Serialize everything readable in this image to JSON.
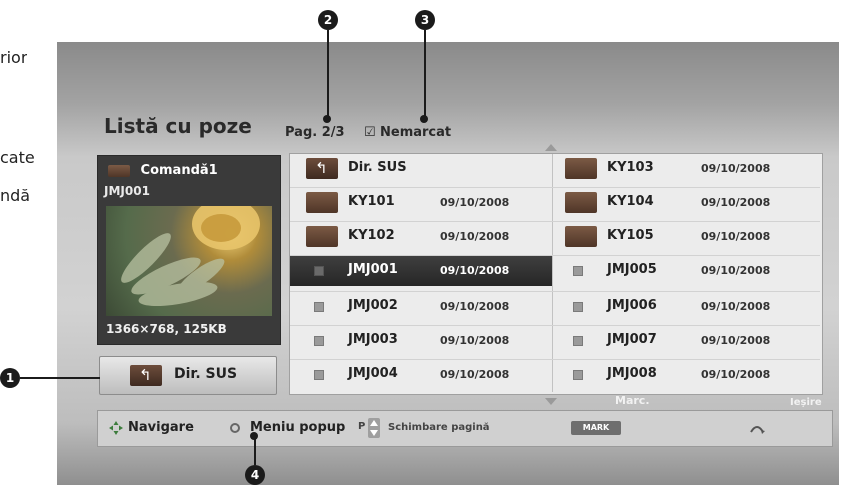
{
  "left_cut_text": [
    "rior",
    "cate",
    "ndă"
  ],
  "callouts": [
    "1",
    "2",
    "3",
    "4"
  ],
  "title": "Listă cu poze",
  "page_indicator": "Pag. 2/3",
  "mark_status": "Nemarcat",
  "checkbox_symbol": "☑",
  "preview": {
    "folder_name": "Comandă1",
    "file_name": "JMJ001",
    "resolution": "1366×768, 125KB"
  },
  "up_button_label": "Dir. SUS",
  "grid": {
    "left": [
      {
        "name": "Dir. SUS",
        "date": "",
        "type": "up"
      },
      {
        "name": "KY101",
        "date": "09/10/2008",
        "type": "folder"
      },
      {
        "name": "KY102",
        "date": "09/10/2008",
        "type": "folder"
      },
      {
        "name": "JMJ001",
        "date": "09/10/2008",
        "type": "file",
        "selected": true
      },
      {
        "name": "JMJ002",
        "date": "09/10/2008",
        "type": "file"
      },
      {
        "name": "JMJ003",
        "date": "09/10/2008",
        "type": "file"
      },
      {
        "name": "JMJ004",
        "date": "09/10/2008",
        "type": "file"
      }
    ],
    "right": [
      {
        "name": "KY103",
        "date": "09/10/2008",
        "type": "folder"
      },
      {
        "name": "KY104",
        "date": "09/10/2008",
        "type": "folder"
      },
      {
        "name": "KY105",
        "date": "09/10/2008",
        "type": "folder"
      },
      {
        "name": "JMJ005",
        "date": "09/10/2008",
        "type": "file"
      },
      {
        "name": "JMJ006",
        "date": "09/10/2008",
        "type": "file"
      },
      {
        "name": "JMJ007",
        "date": "09/10/2008",
        "type": "file"
      },
      {
        "name": "JMJ008",
        "date": "09/10/2008",
        "type": "file"
      }
    ]
  },
  "bottom": {
    "top_marc": "Marc.",
    "top_exit": "Ieșire",
    "navigate": "Navigare",
    "popup": "Meniu popup",
    "page_change": "Schimbare pagină",
    "page_key": "P",
    "mark_key": "MARK"
  }
}
